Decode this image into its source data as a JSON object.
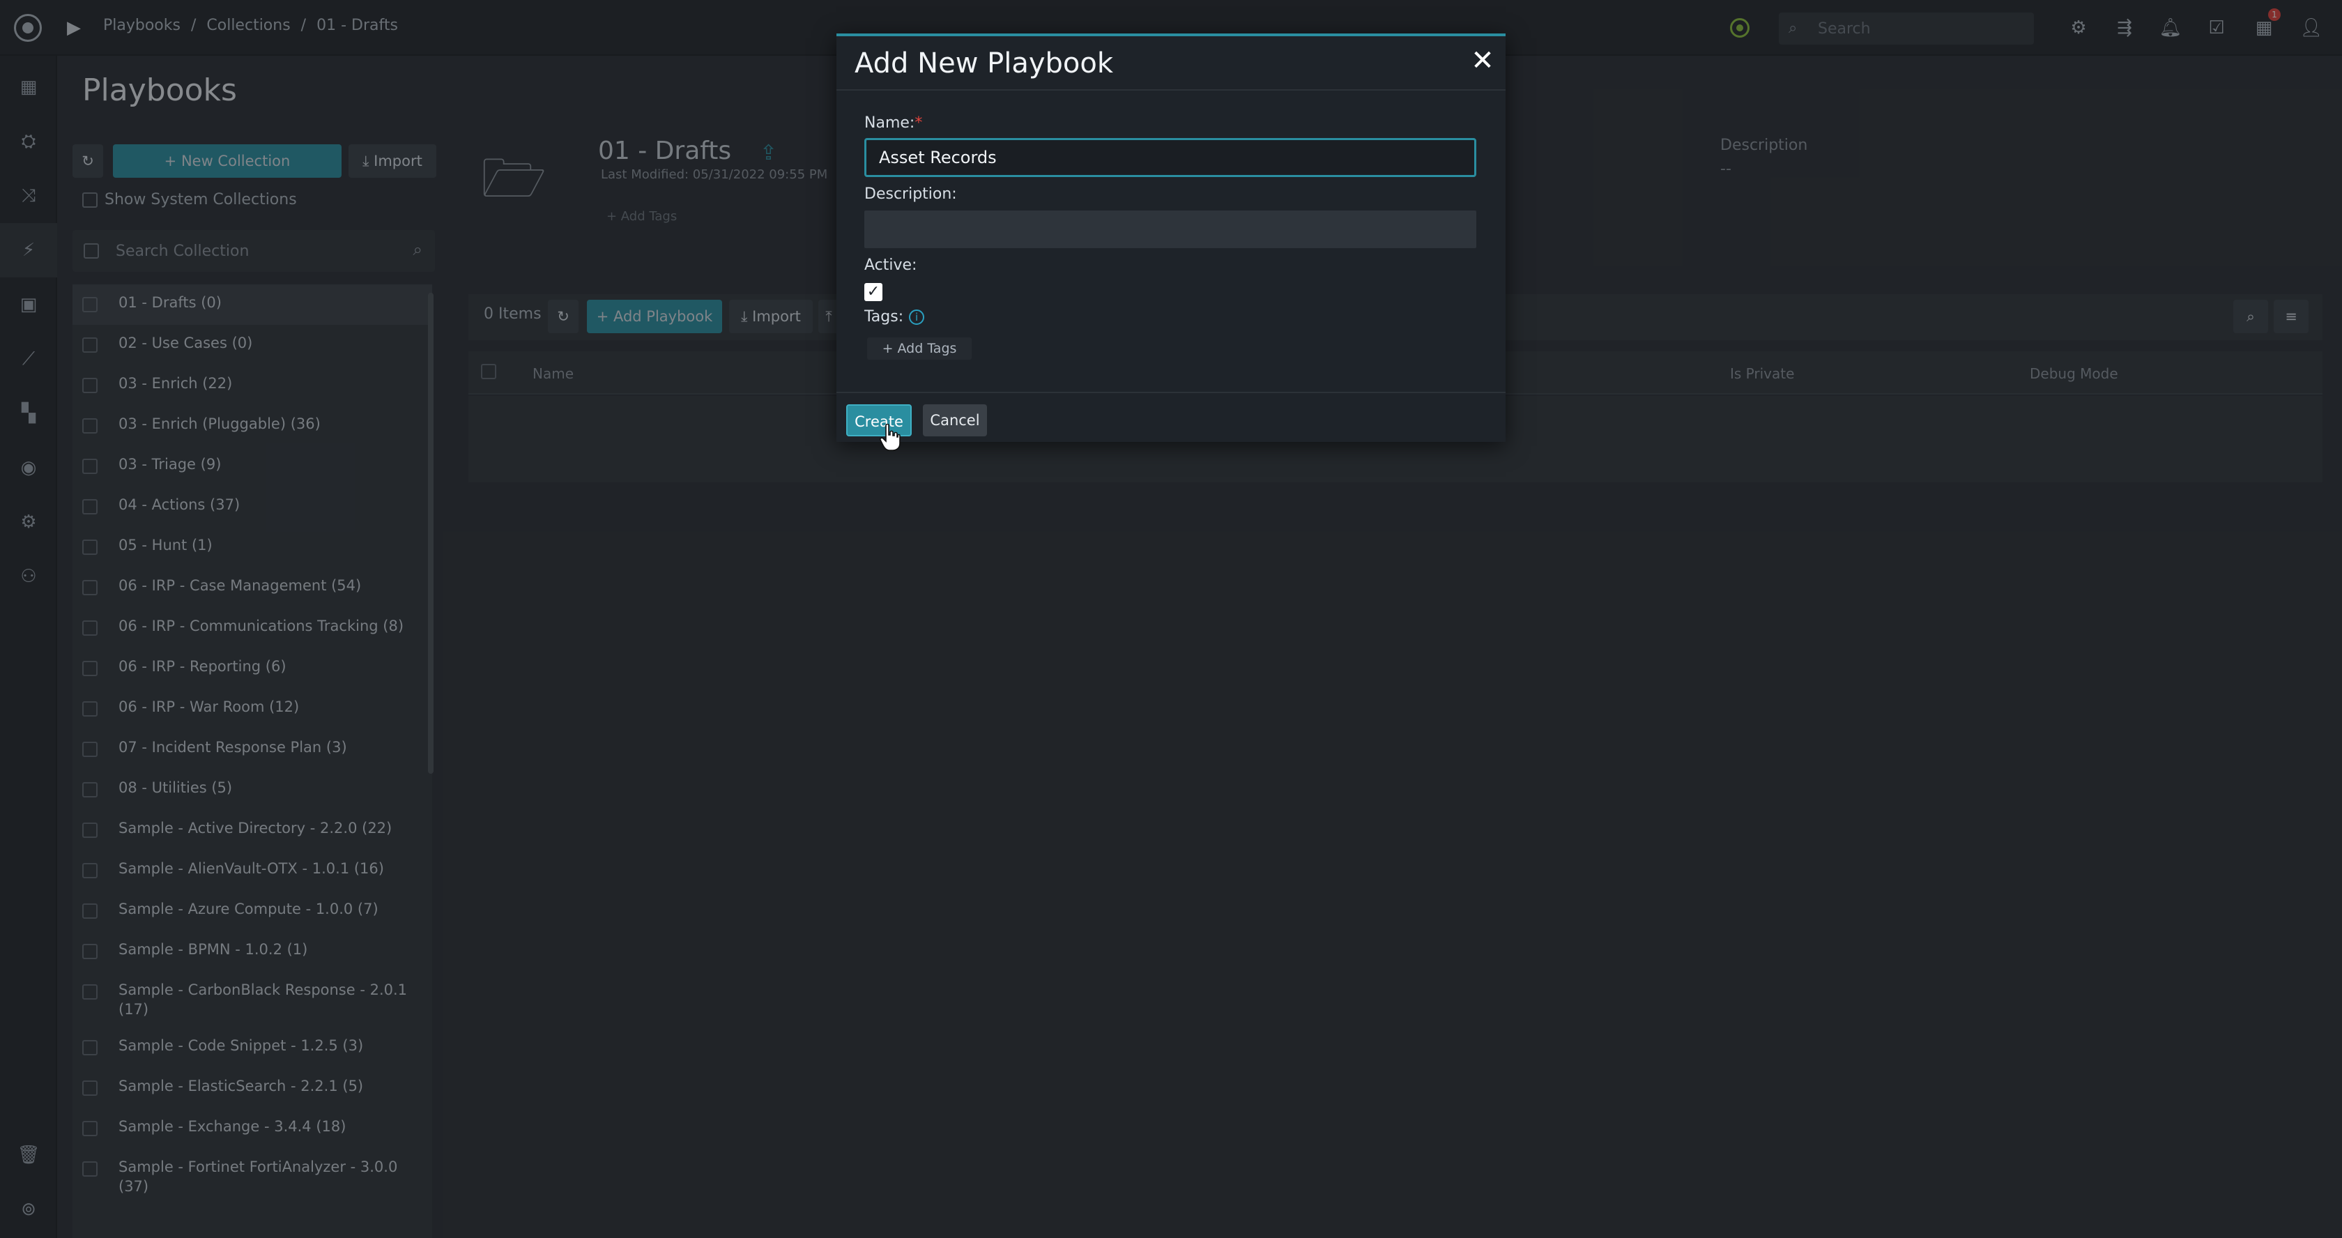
{
  "topbar": {
    "breadcrumb": [
      "Playbooks",
      "/",
      "Collections",
      "/",
      "01 - Drafts"
    ],
    "search_placeholder": "Search",
    "badge_count": "1",
    "icons": [
      "gear-icon",
      "flow-icon",
      "bell-icon",
      "checklist-icon",
      "calendar-icon",
      "user-icon"
    ]
  },
  "leftnav": {
    "items": [
      "dashboard-icon",
      "incidents-icon",
      "shuffle-icon",
      "playbooks-icon",
      "briefcase-icon",
      "reports-icon",
      "apps-icon",
      "deploy-icon",
      "settings-icon",
      "users-icon",
      "trash-icon",
      "footer-icon"
    ]
  },
  "page": {
    "title": "Playbooks"
  },
  "collections": {
    "new_label": "New Collection",
    "import_label": "Import",
    "show_system_label": "Show System Collections",
    "search_placeholder": "Search Collection",
    "items": [
      "01 - Drafts (0)",
      "02 - Use Cases (0)",
      "03 - Enrich (22)",
      "03 - Enrich (Pluggable) (36)",
      "03 - Triage (9)",
      "04 - Actions (37)",
      "05 - Hunt (1)",
      "06 - IRP - Case Management (54)",
      "06 - IRP - Communications Tracking (8)",
      "06 - IRP - Reporting (6)",
      "06 - IRP - War Room (12)",
      "07 - Incident Response Plan (3)",
      "08 - Utilities (5)",
      "Sample - Active Directory - 2.2.0 (22)",
      "Sample - AlienVault-OTX - 1.0.1 (16)",
      "Sample - Azure Compute - 1.0.0 (7)",
      "Sample - BPMN - 1.0.2 (1)",
      "Sample - CarbonBlack Response - 2.0.1 (17)",
      "Sample - Code Snippet - 1.2.5 (3)",
      "Sample - ElasticSearch - 2.2.1 (5)",
      "Sample - Exchange - 3.4.4 (18)",
      "Sample - Fortinet FortiAnalyzer - 3.0.0 (37)"
    ]
  },
  "collection_header": {
    "title": "01 - Drafts",
    "last_modified": "Last Modified: 05/31/2022 09:55 PM",
    "add_tags": "+ Add Tags",
    "description_label": "Description",
    "description_value": "--"
  },
  "playbooks_table": {
    "items_count": "0 Items",
    "add_label": "Add Playbook",
    "import_label": "Import",
    "columns": [
      "Name",
      "Is Private",
      "Debug Mode"
    ]
  },
  "modal": {
    "title": "Add New Playbook",
    "name_label": "Name:",
    "required_mark": "*",
    "name_value": "Asset Records",
    "description_label": "Description:",
    "description_value": "",
    "active_label": "Active:",
    "active_checked": true,
    "tags_label": "Tags:",
    "add_tags_label": "+ Add Tags",
    "create_label": "Create",
    "cancel_label": "Cancel"
  },
  "colors": {
    "accent": "#2a8ea0",
    "background": "#2b2f35",
    "modal": "#1e2329",
    "status_ok": "#8bbf3d",
    "badge": "#e0433c"
  }
}
